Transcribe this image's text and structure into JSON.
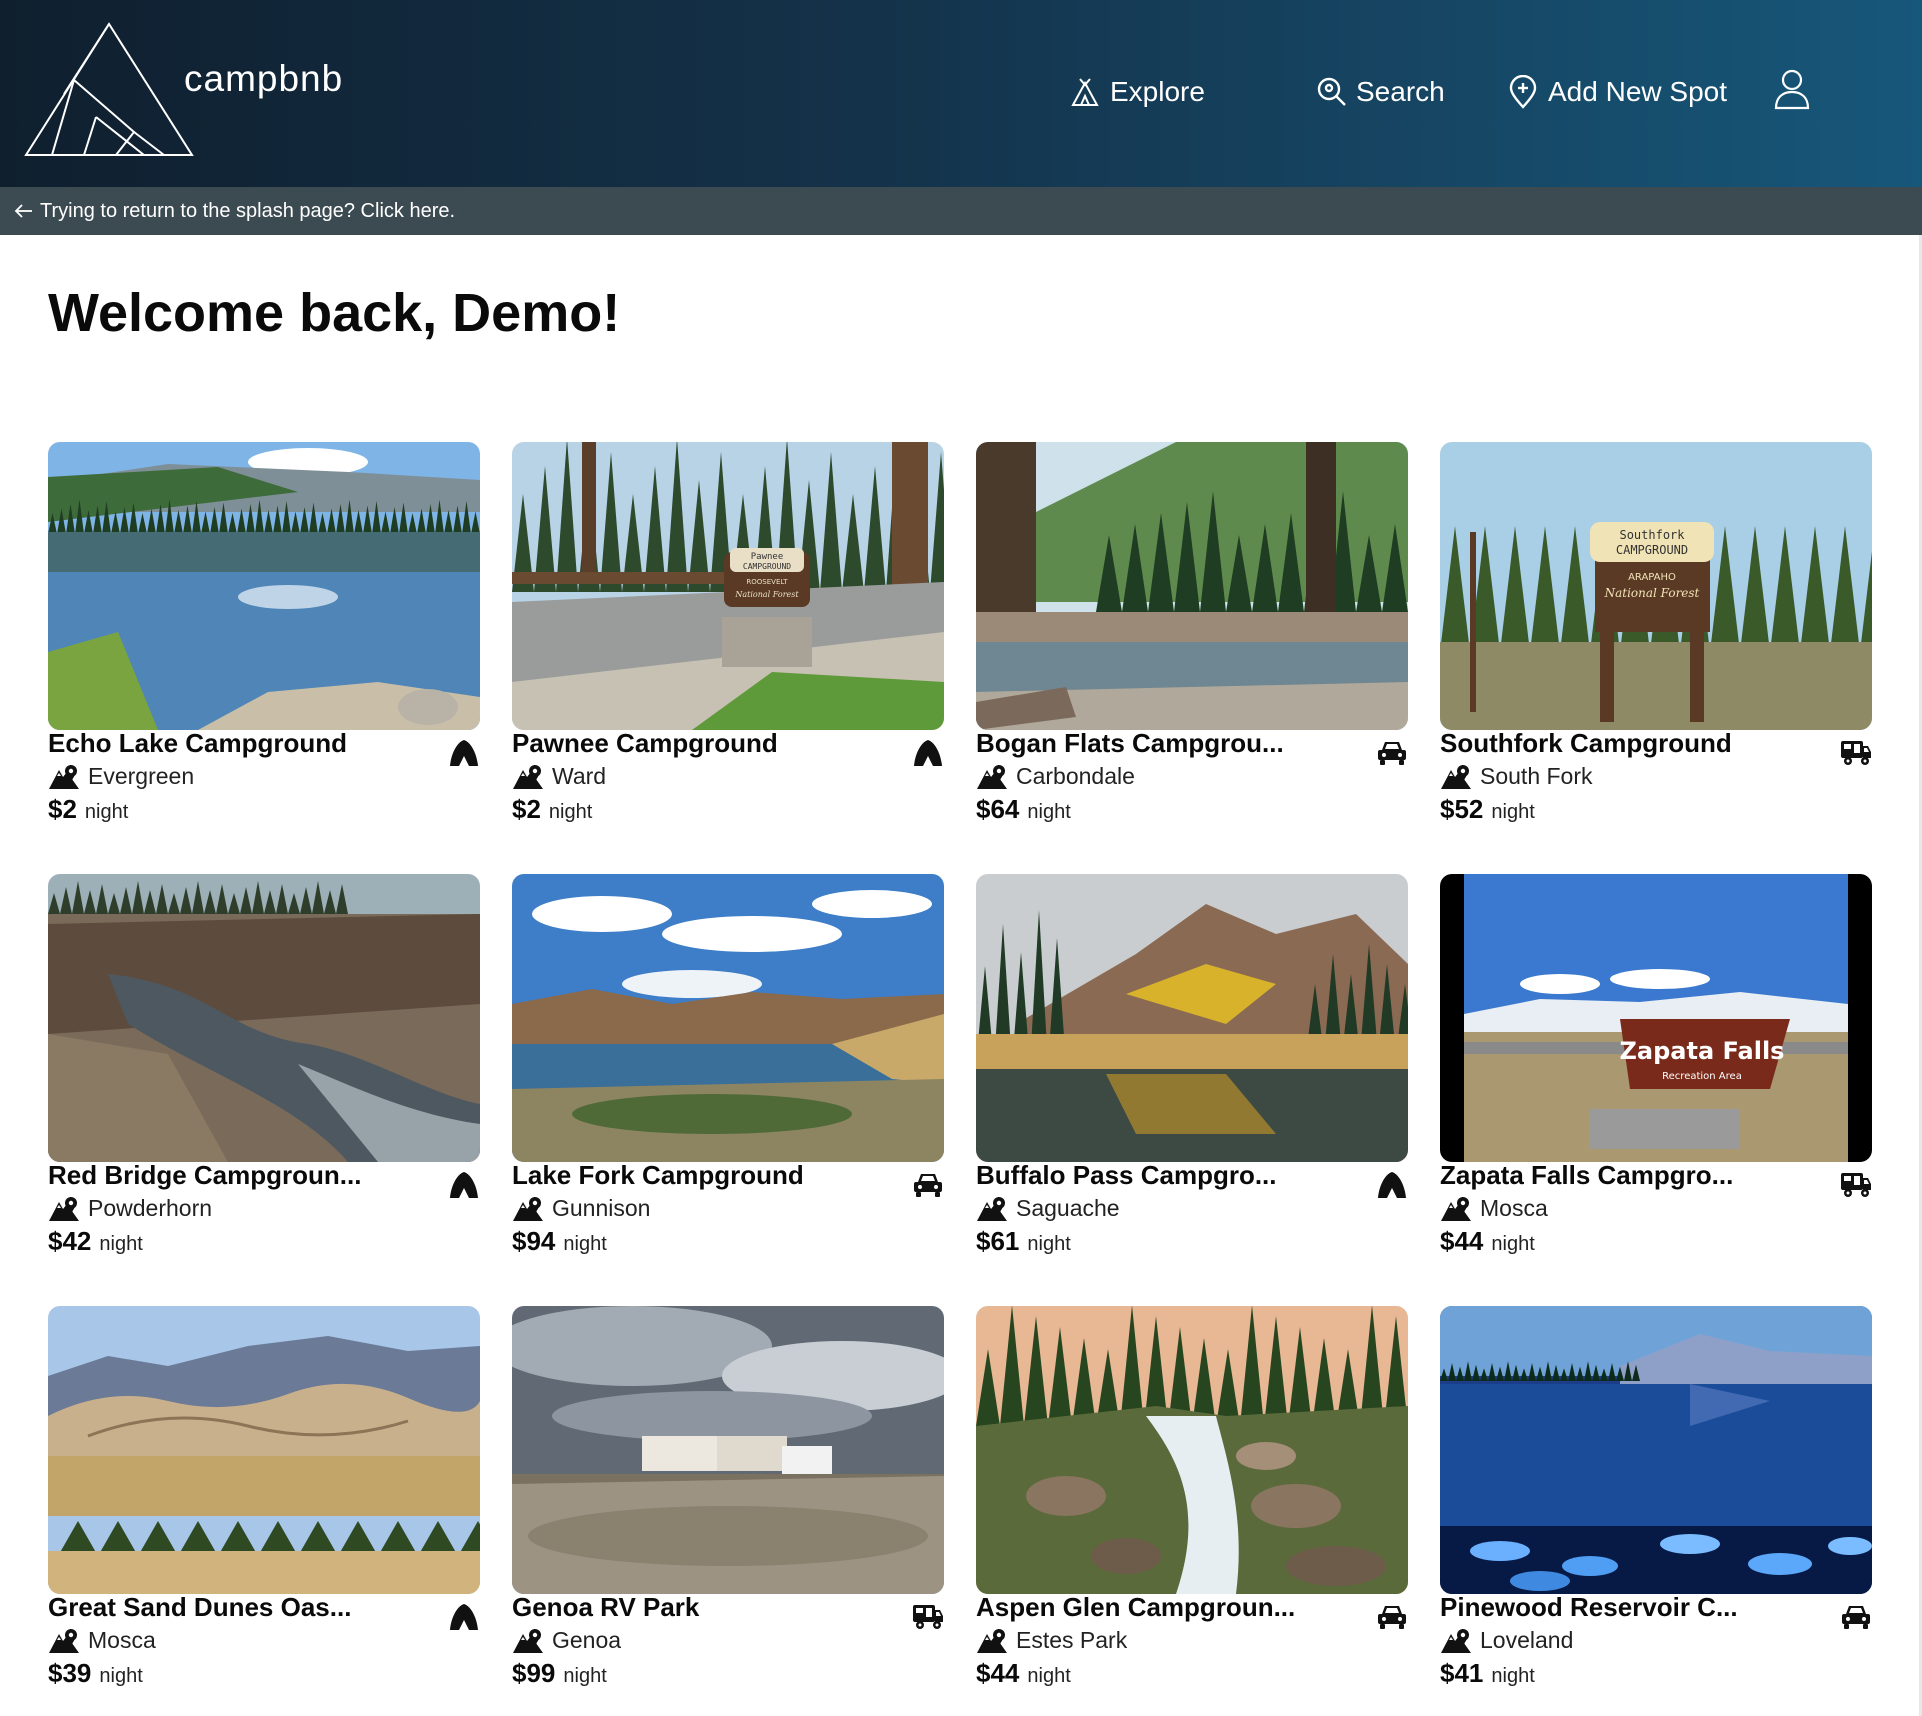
{
  "brand": {
    "name": "campbnb"
  },
  "nav": {
    "explore_label": "Explore",
    "search_label": "Search",
    "add_label": "Add New Spot"
  },
  "splash": {
    "text": "Trying to return to the splash page? Click here."
  },
  "welcome": {
    "text": "Welcome back, Demo!"
  },
  "colors": {
    "header_start": "#0f1f2e",
    "header_end": "#17577a",
    "splash_bar": "#3c4a52"
  },
  "spots": [
    {
      "title": "Echo Lake Campground",
      "location": "Evergreen",
      "price": "$2",
      "unit": "night",
      "type": "tent-icon",
      "scene": "lake"
    },
    {
      "title": "Pawnee Campground",
      "location": "Ward",
      "price": "$2",
      "unit": "night",
      "type": "tent-icon",
      "scene": "sign"
    },
    {
      "title": "Bogan Flats Campgrou...",
      "location": "Carbondale",
      "price": "$64",
      "unit": "night",
      "type": "car-icon",
      "scene": "river"
    },
    {
      "title": "Southfork Campground",
      "location": "South Fork",
      "price": "$52",
      "unit": "night",
      "type": "rv-icon",
      "scene": "sign2"
    },
    {
      "title": "Red Bridge Campgroun...",
      "location": "Powderhorn",
      "price": "$42",
      "unit": "night",
      "type": "tent-icon",
      "scene": "brush"
    },
    {
      "title": "Lake Fork Campground",
      "location": "Gunnison",
      "price": "$94",
      "unit": "night",
      "type": "car-icon",
      "scene": "reservoir"
    },
    {
      "title": "Buffalo Pass Campgro...",
      "location": "Saguache",
      "price": "$61",
      "unit": "night",
      "type": "tent-icon",
      "scene": "autumn"
    },
    {
      "title": "Zapata Falls Campgro...",
      "location": "Mosca",
      "price": "$44",
      "unit": "night",
      "type": "rv-icon",
      "scene": "zapata"
    },
    {
      "title": "Great Sand Dunes Oas...",
      "location": "Mosca",
      "price": "$39",
      "unit": "night",
      "type": "tent-icon",
      "scene": "dunes"
    },
    {
      "title": "Genoa RV Park",
      "location": "Genoa",
      "price": "$99",
      "unit": "night",
      "type": "rv-icon",
      "scene": "rvpark"
    },
    {
      "title": "Aspen Glen Campgroun...",
      "location": "Estes Park",
      "price": "$44",
      "unit": "night",
      "type": "car-icon",
      "scene": "creek"
    },
    {
      "title": "Pinewood Reservoir C...",
      "location": "Loveland",
      "price": "$41",
      "unit": "night",
      "type": "car-icon",
      "scene": "bluelake"
    }
  ],
  "sign_text": {
    "pawnee": [
      "Pawnee",
      "CAMPGROUND",
      "ROOSEVELT",
      "National Forest"
    ],
    "southfork": [
      "Southfork",
      "CAMPGROUND",
      "ARAPAHO",
      "National Forest"
    ],
    "zapata": [
      "Zapata Falls",
      "Recreation Area"
    ]
  }
}
